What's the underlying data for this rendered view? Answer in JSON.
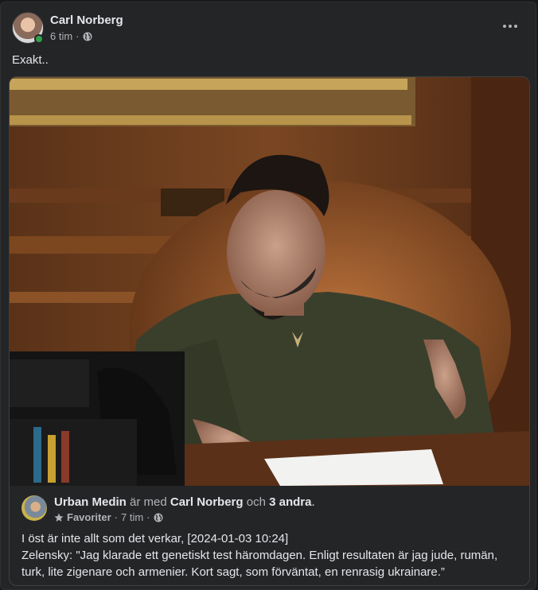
{
  "post": {
    "author": "Carl Norberg",
    "time": "6 tim",
    "separator": "·",
    "text": "Exakt..",
    "more_icon": "more-horizontal-icon",
    "visibility_icon": "globe-icon"
  },
  "shared": {
    "author": "Urban Medin",
    "with_word": "är med",
    "tagged": "Carl Norberg",
    "and_word": "och",
    "others": "3 andra",
    "period": ".",
    "favorites_label": "Favoriter",
    "time": "7 tim",
    "separator": "·",
    "line1": "I öst är inte allt som det verkar, [2024-01-03 10:24]",
    "line2": "Zelensky: \"Jag klarade ett genetiskt test häromdagen. Enligt resultaten är jag jude, rumän, turk, lite zigenare och armenier. Kort sagt, som förväntat, en renrasig ukrainare.”"
  },
  "colors": {
    "bg": "#242526",
    "text": "#e4e6eb",
    "secondary": "#b0b3b8",
    "online": "#31a24c"
  }
}
